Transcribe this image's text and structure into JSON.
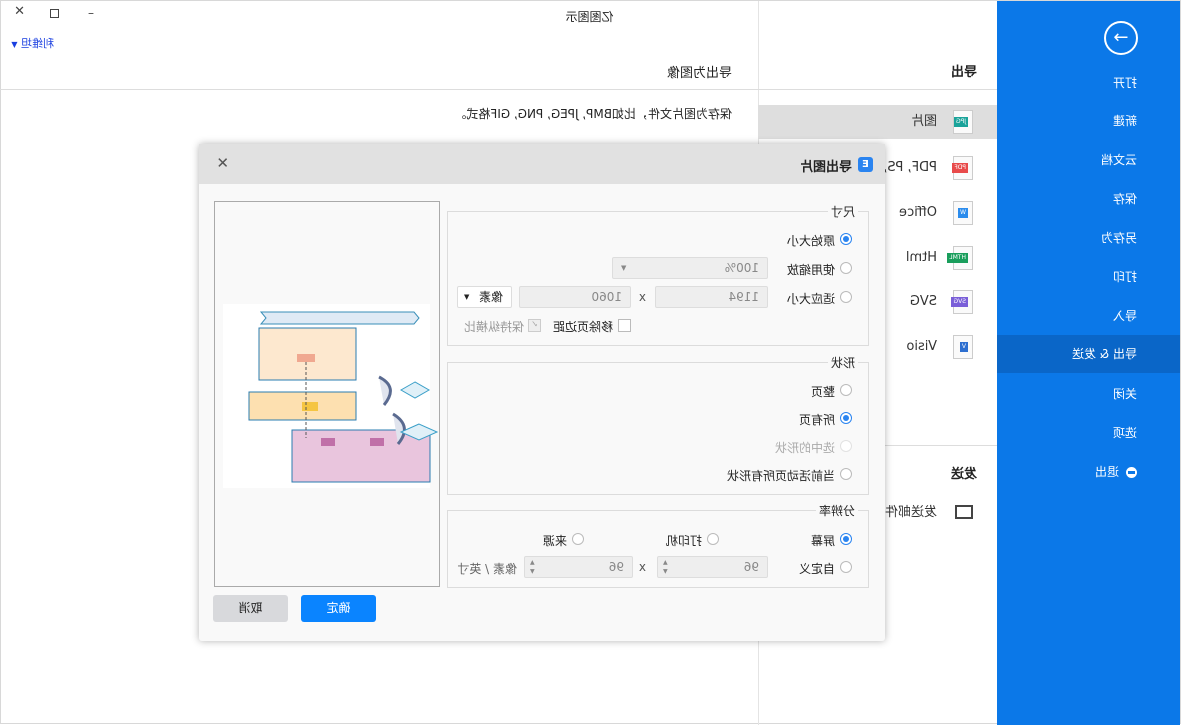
{
  "window": {
    "title": "亿图图示",
    "user": "利维坦",
    "controls": [
      "minimize",
      "maximize",
      "close"
    ]
  },
  "sidebar": {
    "items": [
      {
        "label": "打开"
      },
      {
        "label": "新建"
      },
      {
        "label": "云文档"
      },
      {
        "label": "保存"
      },
      {
        "label": "另存为"
      },
      {
        "label": "打印"
      },
      {
        "label": "导入"
      },
      {
        "label": "导出 & 发送",
        "selected": true
      },
      {
        "label": "关闭"
      },
      {
        "label": "选项"
      },
      {
        "label": "退出"
      }
    ],
    "color": "#0b78e8"
  },
  "export_panel": {
    "title": "导出",
    "items": [
      {
        "label": "图片",
        "badge": "JPG",
        "color": "#1aa39a"
      },
      {
        "label": "PDF, PS, EPS",
        "badge": "PDF",
        "color": "#e84a4a"
      },
      {
        "label": "Office",
        "badge": "W",
        "color": "#2b8ced"
      },
      {
        "label": "Html",
        "badge": "HTML",
        "color": "#1a9e5c"
      },
      {
        "label": "SVG",
        "badge": "SVG",
        "color": "#7a5fd8"
      },
      {
        "label": "Visio",
        "badge": "V",
        "color": "#2e6fd0"
      }
    ],
    "send_title": "发送",
    "send_items": [
      {
        "label": "发送邮件"
      }
    ]
  },
  "content": {
    "title": "导出为图像",
    "description": "保存为图片文件，比如BMP, JPEG, PNG, GIF格式。"
  },
  "dialog": {
    "title": "导出图片",
    "size": {
      "legend": "尺寸",
      "original": "原始大小",
      "use_zoom": "使用缩放",
      "zoom_value": "100%",
      "fit": "适应大小",
      "width": "1194",
      "x": "x",
      "height": "1060",
      "unit": "像素",
      "remove_margin": "移除页边距",
      "keep_ratio": "保持纵横比",
      "selected": "原始大小"
    },
    "shape": {
      "legend": "形状",
      "options": [
        "整页",
        "所有页",
        "选中的形状",
        "当前活动页所有形状"
      ],
      "selected": "所有页"
    },
    "resolution": {
      "legend": "分辨率",
      "screen": "屏幕",
      "printer": "打印机",
      "source": "来源",
      "custom": "自定义",
      "dpi_x": "96",
      "x": "x",
      "dpi_y": "96",
      "unit": "像素 / 英寸",
      "selected": "屏幕"
    },
    "ok": "确定",
    "cancel": "取消"
  }
}
